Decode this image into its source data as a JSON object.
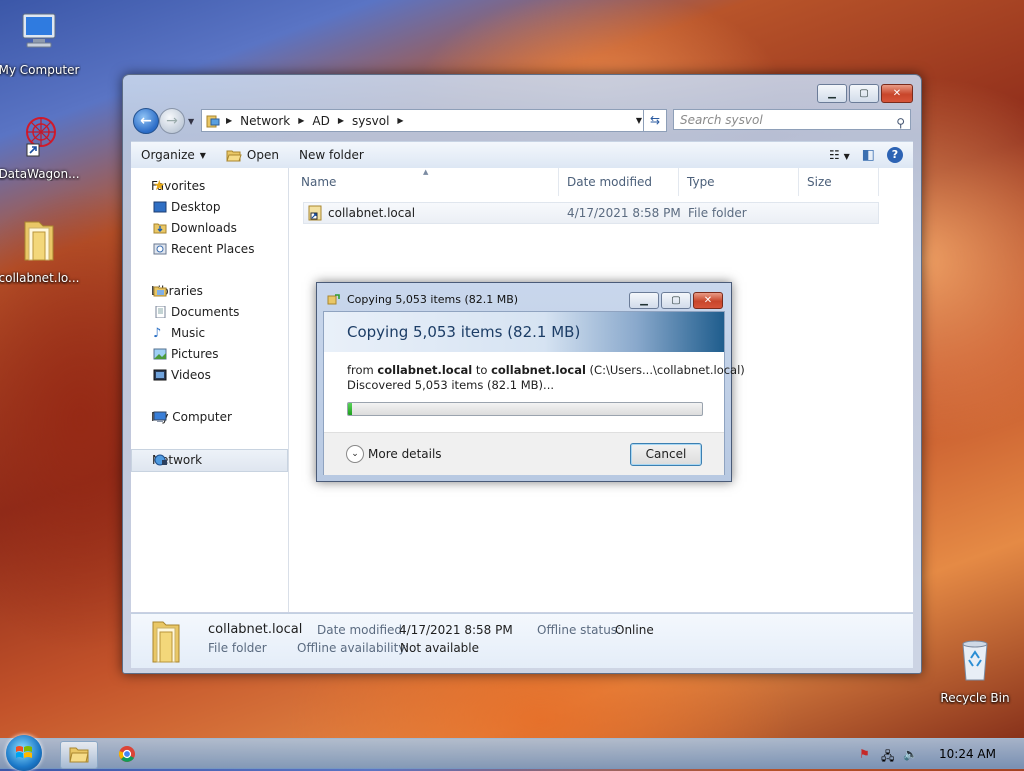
{
  "desktop": {
    "icons": [
      {
        "label": "My Computer"
      },
      {
        "label": "DataWagon..."
      },
      {
        "label": "collabnet.lo..."
      },
      {
        "label": "Recycle Bin"
      }
    ]
  },
  "explorer": {
    "breadcrumb": [
      "Network",
      "AD",
      "sysvol"
    ],
    "search_placeholder": "Search sysvol",
    "toolbar": {
      "organize": "Organize",
      "open": "Open",
      "new_folder": "New folder"
    },
    "nav": {
      "favorites": "Favorites",
      "favorites_items": [
        "Desktop",
        "Downloads",
        "Recent Places"
      ],
      "libraries": "Libraries",
      "libraries_items": [
        "Documents",
        "Music",
        "Pictures",
        "Videos"
      ],
      "computer": "My Computer",
      "network": "Network"
    },
    "columns": [
      "Name",
      "Date modified",
      "Type",
      "Size"
    ],
    "rows": [
      {
        "name": "collabnet.local",
        "date": "4/17/2021 8:58 PM",
        "type": "File folder",
        "size": ""
      }
    ],
    "details": {
      "name": "collabnet.local",
      "type": "File folder",
      "date_label": "Date modified:",
      "date_value": "4/17/2021 8:58 PM",
      "offline_status_label": "Offline status:",
      "offline_status_value": "Online",
      "offline_avail_label": "Offline availability:",
      "offline_avail_value": "Not available"
    }
  },
  "copy_dialog": {
    "title": "Copying 5,053 items (82.1 MB)",
    "heading": "Copying 5,053 items (82.1 MB)",
    "from_prefix": "from ",
    "from_src": "collabnet.local",
    "to_word": " to ",
    "to_dest": "collabnet.local",
    "to_path": " (C:\\Users...\\collabnet.local)",
    "discovered": "Discovered 5,053 items (82.1 MB)...",
    "progress_percent": 1,
    "more_details": "More details",
    "cancel": "Cancel"
  },
  "taskbar": {
    "clock": "10:24 AM"
  },
  "colors": {
    "accent": "#2b6cc7",
    "progress": "#1ea01e",
    "close_button": "#c8462b"
  }
}
